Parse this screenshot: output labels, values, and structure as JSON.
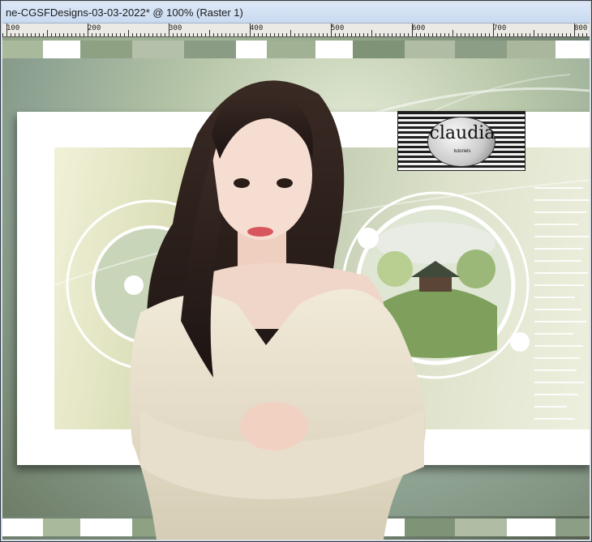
{
  "window": {
    "title": "ne-CGSFDesigns-03-03-2022* @ 100% (Raster 1)"
  },
  "ruler": {
    "labels": [
      "100",
      "200",
      "300",
      "400",
      "500",
      "600",
      "700",
      "800"
    ]
  },
  "canvas": {
    "logo_text": "claudia",
    "logo_subtext": "tutoriels"
  },
  "colors": {
    "accent_green": "#94a88a",
    "frame_white": "#ffffff",
    "title_bg": "#dce8f8"
  }
}
